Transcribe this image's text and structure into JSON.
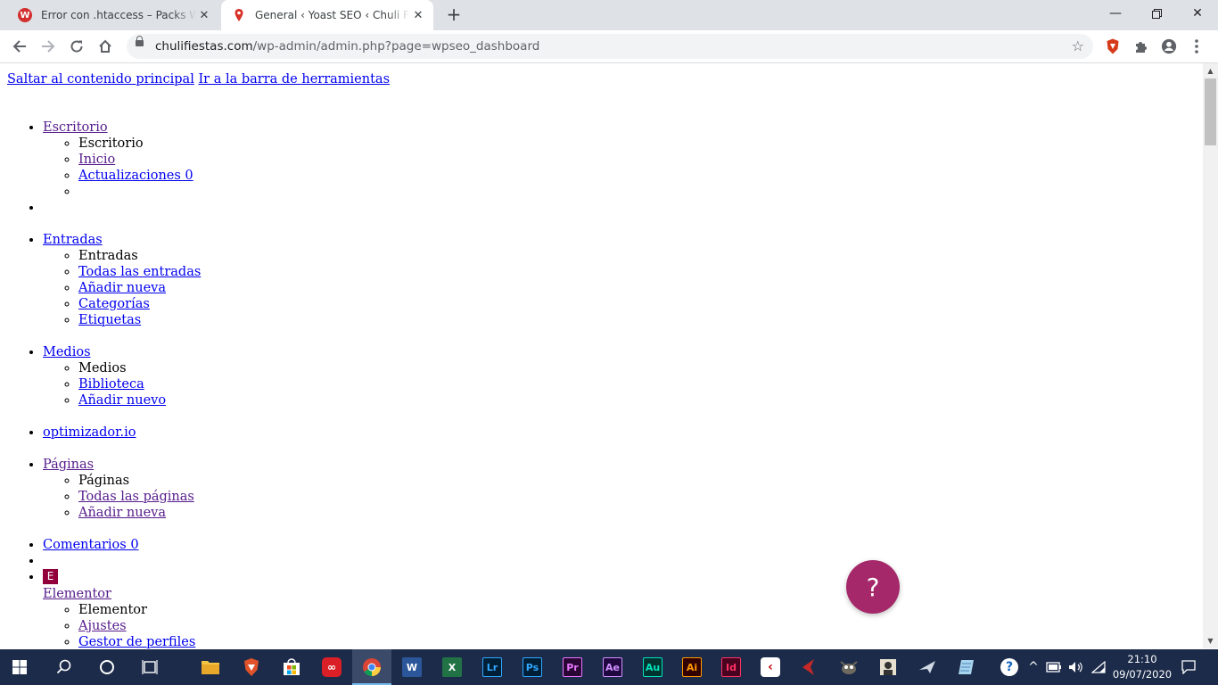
{
  "browser": {
    "tabs": [
      {
        "title": "Error con .htaccess – Packs Weber",
        "favicon": "webempresa-icon",
        "active": false
      },
      {
        "title": "General ‹ Yoast SEO ‹ Chuli Fiestas",
        "favicon": "location-pin-icon",
        "active": true
      }
    ],
    "new_tab_glyph": "+",
    "url_domain": "chulifiestas.com",
    "url_path": "/wp-admin/admin.php?page=wpseo_dashboard"
  },
  "page": {
    "skip_links": [
      "Saltar al contenido principal",
      "Ir a la barra de herramientas"
    ],
    "menu": [
      {
        "label": "Escritorio",
        "visited": true,
        "submenu": [
          {
            "label": "Escritorio",
            "link": false
          },
          {
            "label": "Inicio",
            "link": true,
            "visited": true
          },
          {
            "label": "Actualizaciones 0",
            "link": true
          },
          {
            "label": "",
            "link": false
          }
        ]
      },
      {
        "label": "",
        "separator": true
      },
      {
        "label": "Entradas",
        "submenu": [
          {
            "label": "Entradas",
            "link": false
          },
          {
            "label": "Todas las entradas",
            "link": true
          },
          {
            "label": "Añadir nueva",
            "link": true
          },
          {
            "label": "Categorías",
            "link": true
          },
          {
            "label": "Etiquetas",
            "link": true
          }
        ]
      },
      {
        "label": "Medios",
        "submenu": [
          {
            "label": "Medios",
            "link": false
          },
          {
            "label": "Biblioteca",
            "link": true
          },
          {
            "label": "Añadir nuevo",
            "link": true
          }
        ]
      },
      {
        "label": "optimizador.io"
      },
      {
        "label": "Páginas",
        "visited": true,
        "submenu": [
          {
            "label": "Páginas",
            "link": false
          },
          {
            "label": "Todas las páginas",
            "link": true,
            "visited": true
          },
          {
            "label": "Añadir nueva",
            "link": true,
            "visited": true
          }
        ]
      },
      {
        "label": "Comentarios 0"
      },
      {
        "label": "",
        "separator": true
      },
      {
        "label": "Elementor",
        "visited": true,
        "icon": "elementor-icon",
        "submenu": [
          {
            "label": "Elementor",
            "link": false
          },
          {
            "label": "Ajustes",
            "link": true,
            "visited": true
          },
          {
            "label": "Gestor de perfiles",
            "link": true
          }
        ]
      }
    ],
    "help_button_label": "?"
  },
  "taskbar": {
    "apps": [
      {
        "name": "start-icon"
      },
      {
        "name": "search-icon"
      },
      {
        "name": "cortana-icon"
      },
      {
        "name": "task-view-icon"
      },
      {
        "name": "file-explorer-icon"
      },
      {
        "name": "brave-icon"
      },
      {
        "name": "store-icon"
      },
      {
        "name": "creative-cloud-icon"
      },
      {
        "name": "chrome-icon"
      },
      {
        "name": "word-icon"
      },
      {
        "name": "excel-icon"
      },
      {
        "name": "lightroom-icon",
        "text": "Lr"
      },
      {
        "name": "photoshop-icon",
        "text": "Ps"
      },
      {
        "name": "premiere-icon",
        "text": "Pr"
      },
      {
        "name": "after-effects-icon",
        "text": "Ae"
      },
      {
        "name": "audition-icon",
        "text": "Au"
      },
      {
        "name": "illustrator-icon",
        "text": "Ai"
      },
      {
        "name": "indesign-icon",
        "text": "Id"
      }
    ],
    "time": "21:10",
    "date": "09/07/2020"
  },
  "colors": {
    "link": "#0000ee",
    "visited_link": "#551a8b",
    "help_button": "#a4286a",
    "elementor": "#92003b",
    "taskbar": "#1c2b4a"
  }
}
